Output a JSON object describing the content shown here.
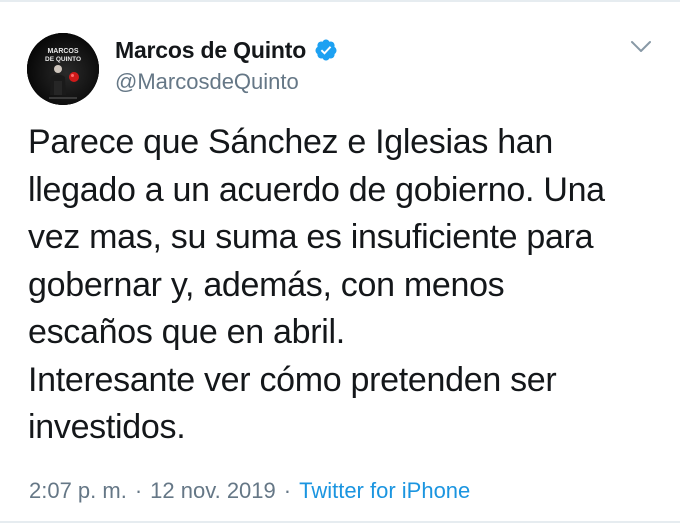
{
  "author": {
    "display_name": "Marcos de Quinto",
    "handle": "@MarcosdeQuinto",
    "verified": true,
    "avatar_text": [
      "MARCOS",
      "DE QUINTO"
    ]
  },
  "tweet": {
    "text": "Parece que Sánchez e Iglesias han\nllegado a un acuerdo de gobierno. Una\nvez mas, su suma es insuficiente para\ngobernar y, además, con menos\nescaños que en abril.\nInteresante ver cómo pretenden ser\ninvestidos.",
    "time": "2:07 p. m.",
    "separator": "·",
    "date": "12 nov. 2019",
    "source": "Twitter for iPhone"
  },
  "icons": {
    "verified": "verified-badge-icon",
    "more": "chevron-down-icon"
  },
  "colors": {
    "accent": "#1b95e0",
    "verified": "#1da1f2",
    "secondary_text": "#657786",
    "primary_text": "#14171a"
  }
}
